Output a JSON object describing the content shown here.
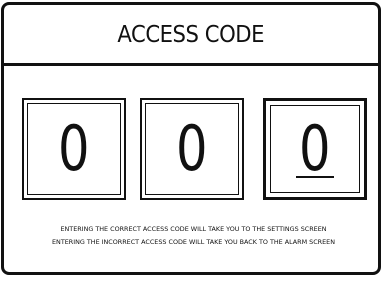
{
  "header": {
    "title": "ACCESS CODE"
  },
  "code": {
    "digits": [
      "0",
      "0",
      "0"
    ],
    "selected_index": 2
  },
  "info": {
    "line1": "ENTERING THE CORRECT ACCESS CODE WILL TAKE YOU TO THE SETTINGS SCREEN",
    "line2": "ENTERING THE INCORRECT ACCESS CODE WILL TAKE YOU BACK TO THE ALARM SCREEN"
  },
  "colors": {
    "foreground": "#111111",
    "background": "#ffffff"
  }
}
